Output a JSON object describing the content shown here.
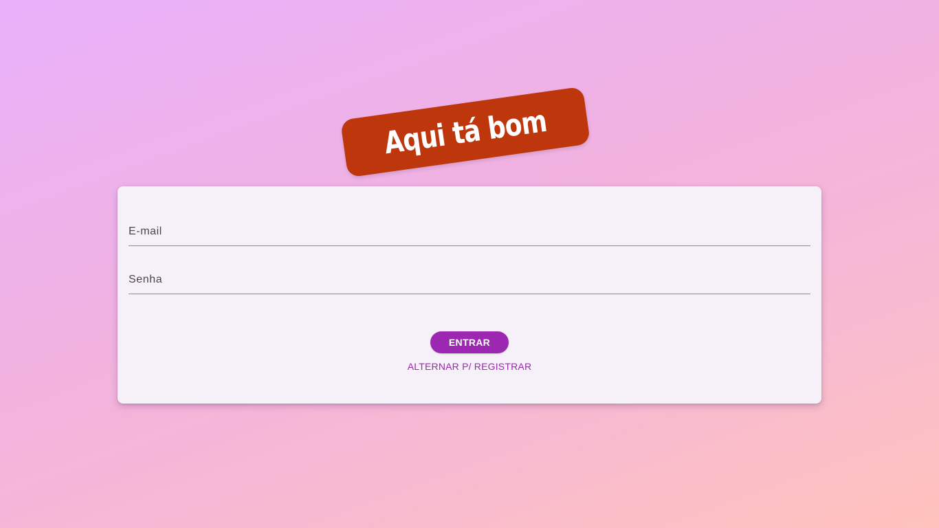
{
  "logo": {
    "text": "Aqui tá bom",
    "background": "#be360c"
  },
  "form": {
    "email_placeholder": "E-mail",
    "password_placeholder": "Senha",
    "submit_label": "ENTRAR",
    "toggle_label": "ALTERNAR P/ REGISTRAR"
  },
  "colors": {
    "accent": "#9c27b0",
    "card_background": "#f6f0f8"
  }
}
